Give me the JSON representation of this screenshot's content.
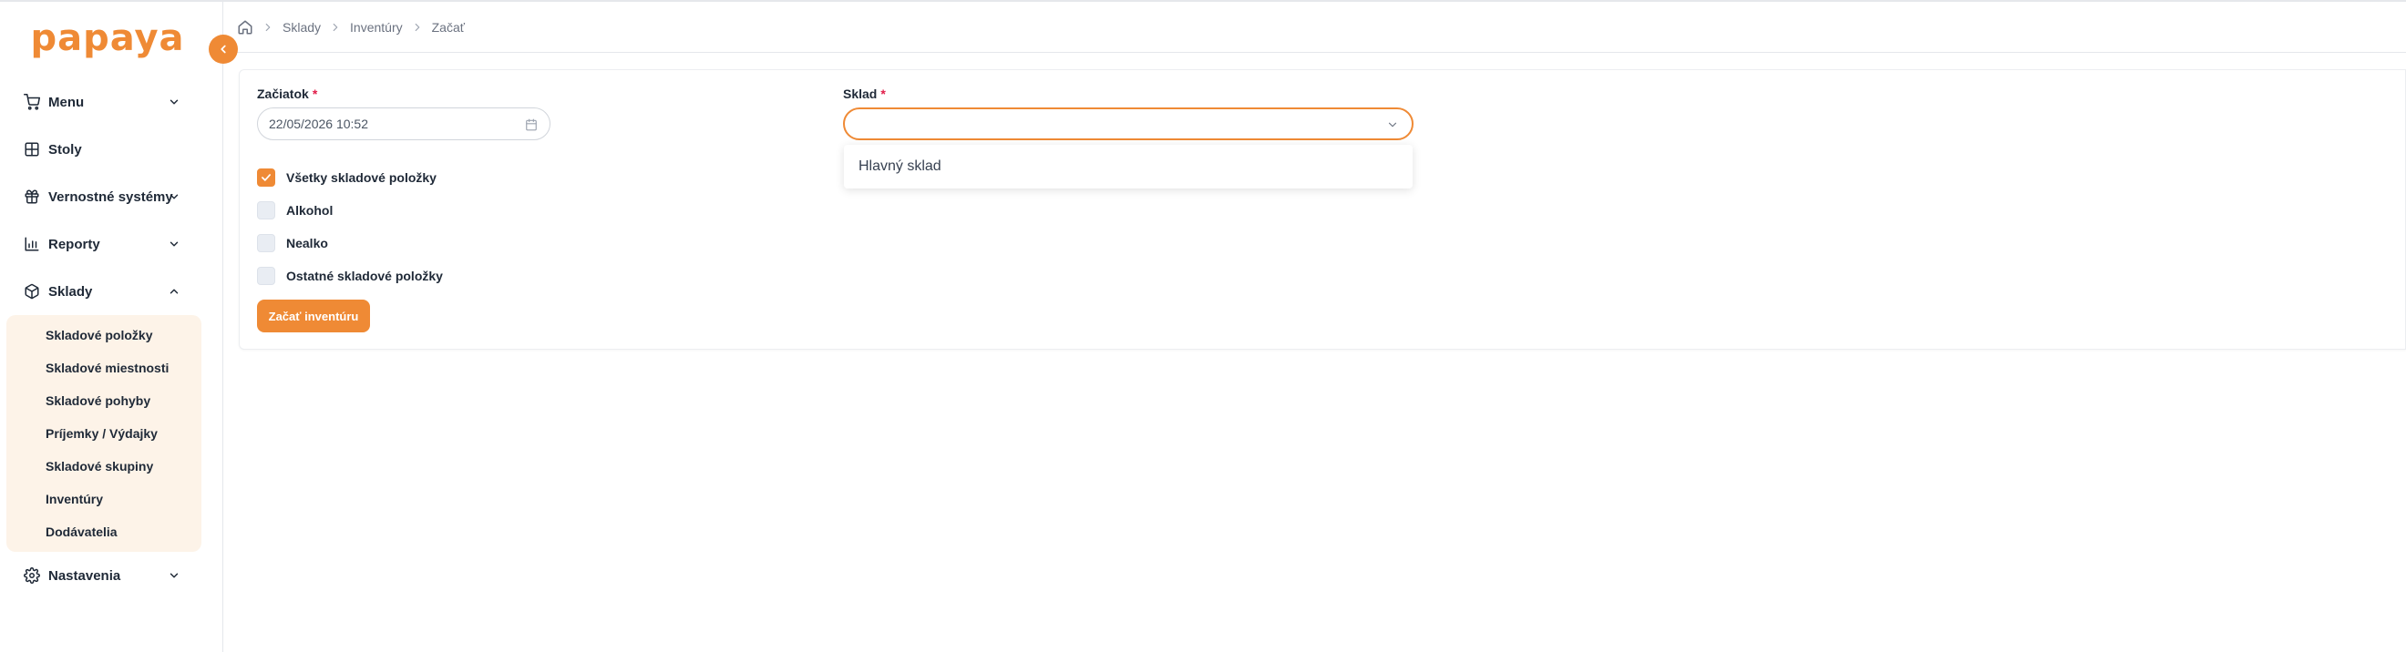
{
  "app": {
    "logo_text": "papaya"
  },
  "breadcrumb": {
    "items": [
      "Sklady",
      "Inventúry",
      "Začať"
    ]
  },
  "sidebar": {
    "items": [
      {
        "label": "Menu",
        "icon": "cart-icon",
        "chevron": "down"
      },
      {
        "label": "Stoly",
        "icon": "table-grid-icon",
        "chevron": ""
      },
      {
        "label": "Vernostné systémy",
        "icon": "gift-icon",
        "chevron": "down"
      },
      {
        "label": "Reporty",
        "icon": "bar-chart-icon",
        "chevron": "down"
      },
      {
        "label": "Sklady",
        "icon": "package-icon",
        "chevron": "up"
      },
      {
        "label": "Nastavenia",
        "icon": "gear-icon",
        "chevron": "down"
      }
    ],
    "submenu": [
      "Skladové položky",
      "Skladové miestnosti",
      "Skladové pohyby",
      "Príjemky / Výdajky",
      "Skladové skupiny",
      "Inventúry",
      "Dodávatelia"
    ]
  },
  "form": {
    "start_label": "Začiatok",
    "start_value": "22/05/2026 10:52",
    "warehouse_label": "Sklad",
    "warehouse_value": "",
    "required_mark": "*",
    "dropdown_options": [
      "Hlavný sklad"
    ],
    "checkboxes": [
      {
        "label": "Všetky skladové položky",
        "checked": true
      },
      {
        "label": "Alkohol",
        "checked": false
      },
      {
        "label": "Nealko",
        "checked": false
      },
      {
        "label": "Ostatné skladové položky",
        "checked": false
      }
    ],
    "submit_label": "Začať inventúru"
  },
  "colors": {
    "accent": "#ef8a35",
    "submenu_bg": "#fdf3e8",
    "required": "#e11d48"
  }
}
